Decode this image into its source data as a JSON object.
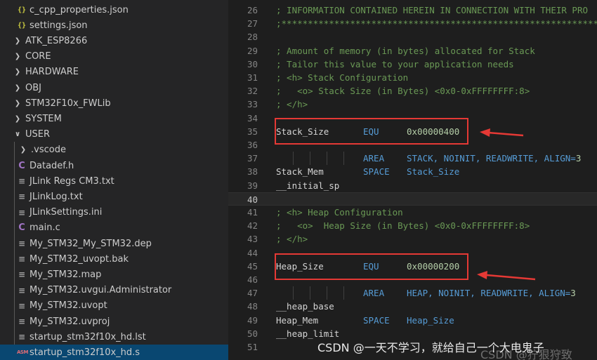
{
  "explorer": {
    "items": [
      {
        "label": "c_cpp_properties.json",
        "icon": "json-braces-icon"
      },
      {
        "label": "settings.json",
        "icon": "json-braces-icon"
      },
      {
        "label": "ATK_ESP8266",
        "icon": "chevron-right-icon"
      },
      {
        "label": "CORE",
        "icon": "chevron-right-icon"
      },
      {
        "label": "HARDWARE",
        "icon": "chevron-right-icon"
      },
      {
        "label": "OBJ",
        "icon": "chevron-right-icon"
      },
      {
        "label": "STM32F10x_FWLib",
        "icon": "chevron-right-icon"
      },
      {
        "label": "SYSTEM",
        "icon": "chevron-right-icon"
      },
      {
        "label": "USER",
        "icon": "chevron-down-icon"
      },
      {
        "label": ".vscode",
        "icon": "chevron-right-icon"
      },
      {
        "label": "Datadef.h",
        "icon": "c-file-icon"
      },
      {
        "label": "JLink Regs CM3.txt",
        "icon": "text-file-icon"
      },
      {
        "label": "JLinkLog.txt",
        "icon": "text-file-icon"
      },
      {
        "label": "JLinkSettings.ini",
        "icon": "text-file-icon"
      },
      {
        "label": "main.c",
        "icon": "c-file-icon"
      },
      {
        "label": "My_STM32_My_STM32.dep",
        "icon": "text-file-icon"
      },
      {
        "label": "My_STM32_uvopt.bak",
        "icon": "text-file-icon"
      },
      {
        "label": "My_STM32.map",
        "icon": "text-file-icon"
      },
      {
        "label": "My_STM32.uvgui.Administrator",
        "icon": "text-file-icon"
      },
      {
        "label": "My_STM32.uvopt",
        "icon": "text-file-icon"
      },
      {
        "label": "My_STM32.uvproj",
        "icon": "text-file-icon"
      },
      {
        "label": "startup_stm32f10x_hd.lst",
        "icon": "text-file-icon"
      },
      {
        "label": "startup_stm32f10x_hd.s",
        "icon": "asm-file-icon"
      }
    ],
    "icon_glyphs": {
      "json": "{}",
      "chevron_right": "❯",
      "chevron_down": "∨",
      "c": "C",
      "text": "≡",
      "asm": "ASM"
    },
    "selected_file": "startup_stm32f10x_hd.s"
  },
  "editor": {
    "lines": [
      {
        "num": "26",
        "text": "; INFORMATION CONTAINED HEREIN IN CONNECTION WITH THEIR PRO"
      },
      {
        "num": "27",
        "text": ";******************************************************************"
      },
      {
        "num": "28",
        "text": ""
      },
      {
        "num": "29",
        "text": "; Amount of memory (in bytes) allocated for Stack"
      },
      {
        "num": "30",
        "text": "; Tailor this value to your application needs"
      },
      {
        "num": "31",
        "text": "; <h> Stack Configuration"
      },
      {
        "num": "32",
        "text": ";   <o> Stack Size (in Bytes) <0x0-0xFFFFFFFF:8>"
      },
      {
        "num": "33",
        "text": "; </h>"
      },
      {
        "num": "34",
        "text": ""
      },
      {
        "num": "35",
        "label": "Stack_Size",
        "kw": "EQU",
        "value": "0x00000400"
      },
      {
        "num": "36",
        "text": ""
      },
      {
        "num": "37",
        "kw": "AREA",
        "args": "STACK, NOINIT, READWRITE, ALIGN=",
        "argnum": "3"
      },
      {
        "num": "38",
        "label": "Stack_Mem",
        "kw": "SPACE",
        "args": "Stack_Size"
      },
      {
        "num": "39",
        "label": "__initial_sp"
      },
      {
        "num": "40",
        "text": ""
      },
      {
        "num": "41",
        "text": "; <h> Heap Configuration"
      },
      {
        "num": "42",
        "text": ";   <o>  Heap Size (in Bytes) <0x0-0xFFFFFFFF:8>"
      },
      {
        "num": "43",
        "text": "; </h>"
      },
      {
        "num": "44",
        "text": ""
      },
      {
        "num": "45",
        "label": "Heap_Size",
        "kw": "EQU",
        "value": "0x00000200"
      },
      {
        "num": "46",
        "text": ""
      },
      {
        "num": "47",
        "kw": "AREA",
        "args": "HEAP, NOINIT, READWRITE, ALIGN=",
        "argnum": "3"
      },
      {
        "num": "48",
        "label": "__heap_base"
      },
      {
        "num": "49",
        "label": "Heap_Mem",
        "kw": "SPACE",
        "args": "Heap_Size"
      },
      {
        "num": "50",
        "label": "__heap_limit"
      },
      {
        "num": "51",
        "text": ""
      }
    ],
    "active_line": "40"
  },
  "watermark": {
    "text": "CSDN @一天不学习，就给自己一个大电鬼子",
    "text2": "CSDN @狞狠狩致"
  },
  "colors": {
    "comment": "#6a9955",
    "keyword": "#569cd6",
    "number": "#b5cea8",
    "highlight": "#e53935",
    "selection": "#094771"
  }
}
